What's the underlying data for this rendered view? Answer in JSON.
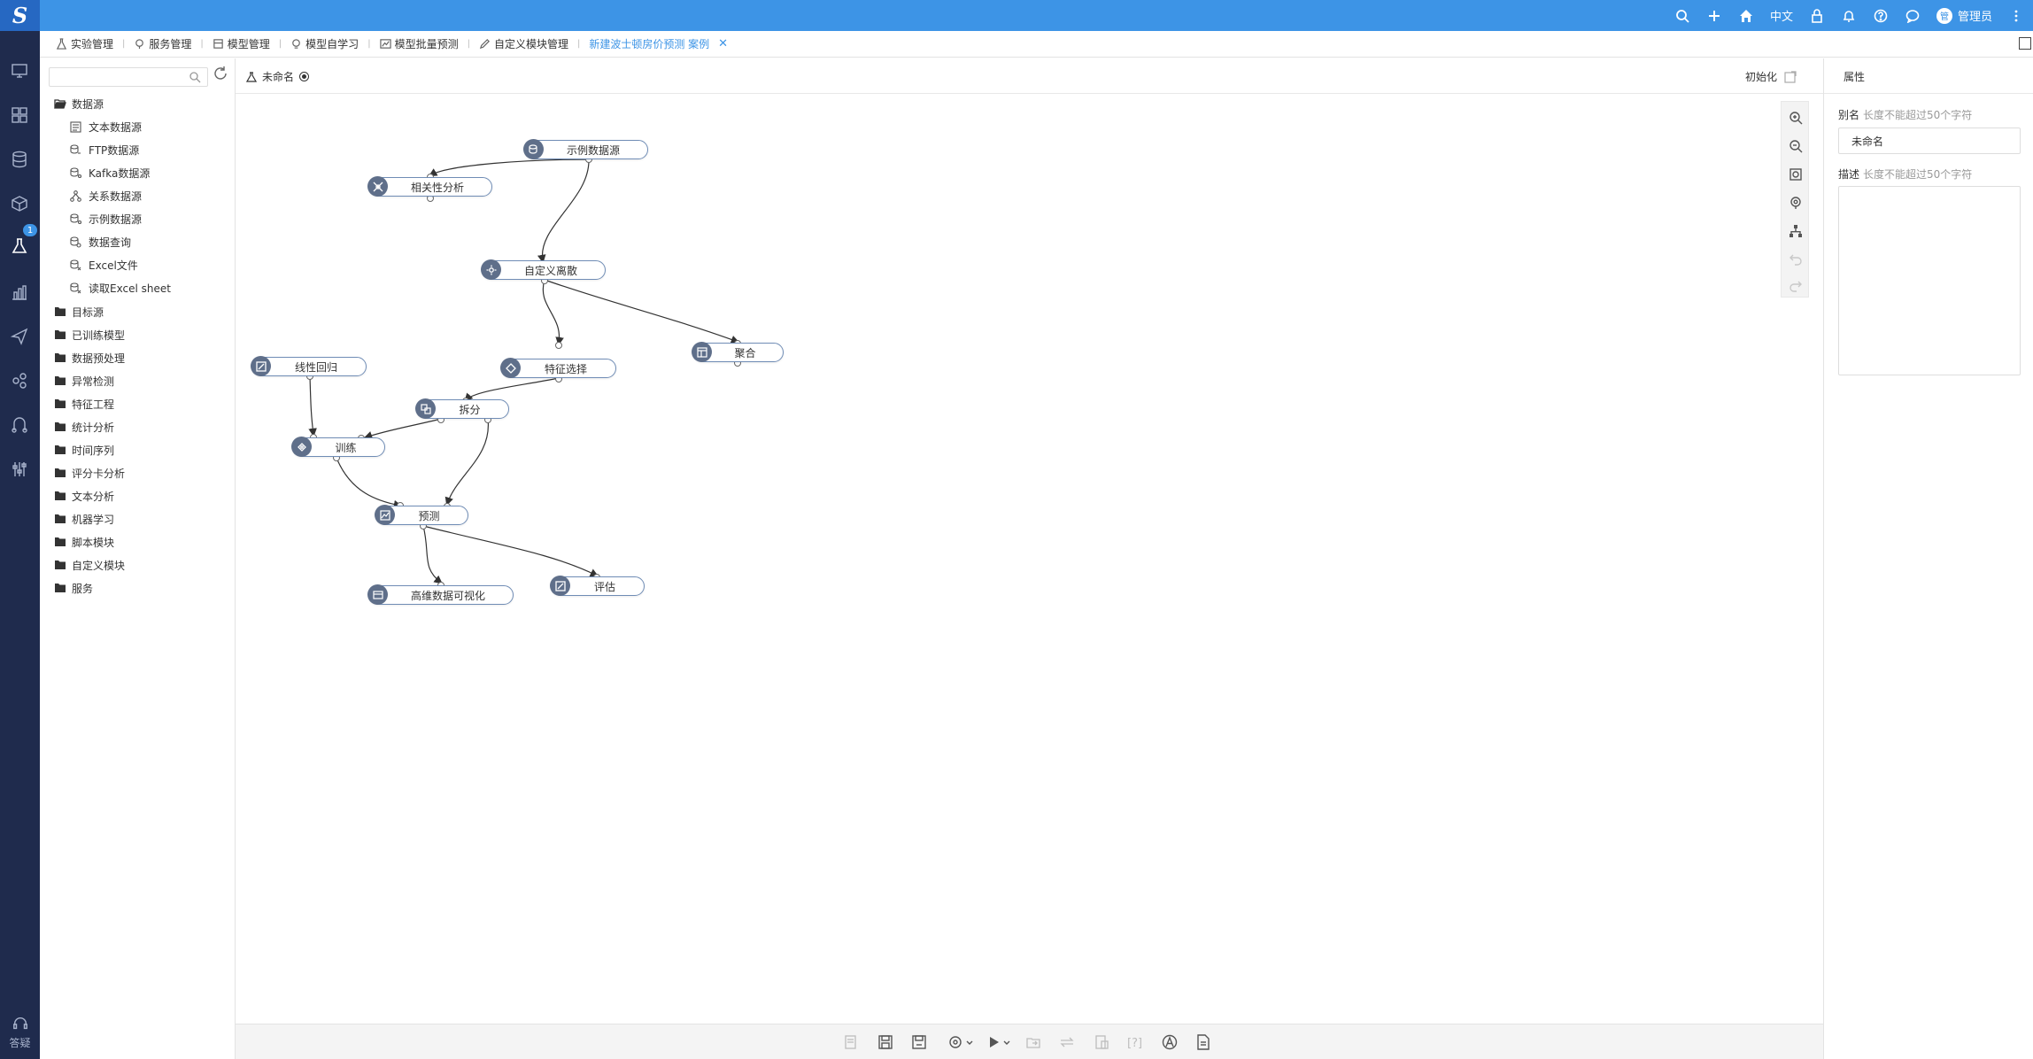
{
  "app": {
    "logo": "S"
  },
  "topbar": {
    "language": "中文",
    "user": "管理员",
    "avatar_text": "管"
  },
  "nav": {
    "badge": "1",
    "help_label": "答疑"
  },
  "tabs": [
    {
      "label": "实验管理",
      "icon": "flask-icon"
    },
    {
      "label": "服务管理",
      "icon": "service-icon"
    },
    {
      "label": "模型管理",
      "icon": "model-icon"
    },
    {
      "label": "模型自学习",
      "icon": "bulb-icon"
    },
    {
      "label": "模型批量预测",
      "icon": "chart-icon"
    },
    {
      "label": "自定义模块管理",
      "icon": "edit-icon"
    },
    {
      "label": "新建波士顿房价预测 案例",
      "active": true
    }
  ],
  "tree": {
    "search_placeholder": "",
    "datasource_group": "数据源",
    "datasource_items": [
      "文本数据源",
      "FTP数据源",
      "Kafka数据源",
      "关系数据源",
      "示例数据源",
      "数据查询",
      "Excel文件",
      "读取Excel sheet"
    ],
    "folders": [
      "目标源",
      "已训练模型",
      "数据预处理",
      "异常检测",
      "特征工程",
      "统计分析",
      "时间序列",
      "评分卡分析",
      "文本分析",
      "机器学习",
      "脚本模块",
      "自定义模块",
      "服务"
    ]
  },
  "canvas": {
    "experiment_name": "未命名",
    "init_label": "初始化",
    "nodes": {
      "sample": "示例数据源",
      "corr": "相关性分析",
      "custom": "自定义离散",
      "agg": "聚合",
      "feat": "特征选择",
      "linreg": "线性回归",
      "split": "拆分",
      "train": "训练",
      "predict": "预测",
      "eval": "评估",
      "viz": "高维数据可视化"
    }
  },
  "properties": {
    "tab": "属性",
    "alias_label": "别名",
    "alias_hint": "长度不能超过50个字符",
    "alias_value": "未命名",
    "desc_label": "描述",
    "desc_hint": "长度不能超过50个字符"
  }
}
